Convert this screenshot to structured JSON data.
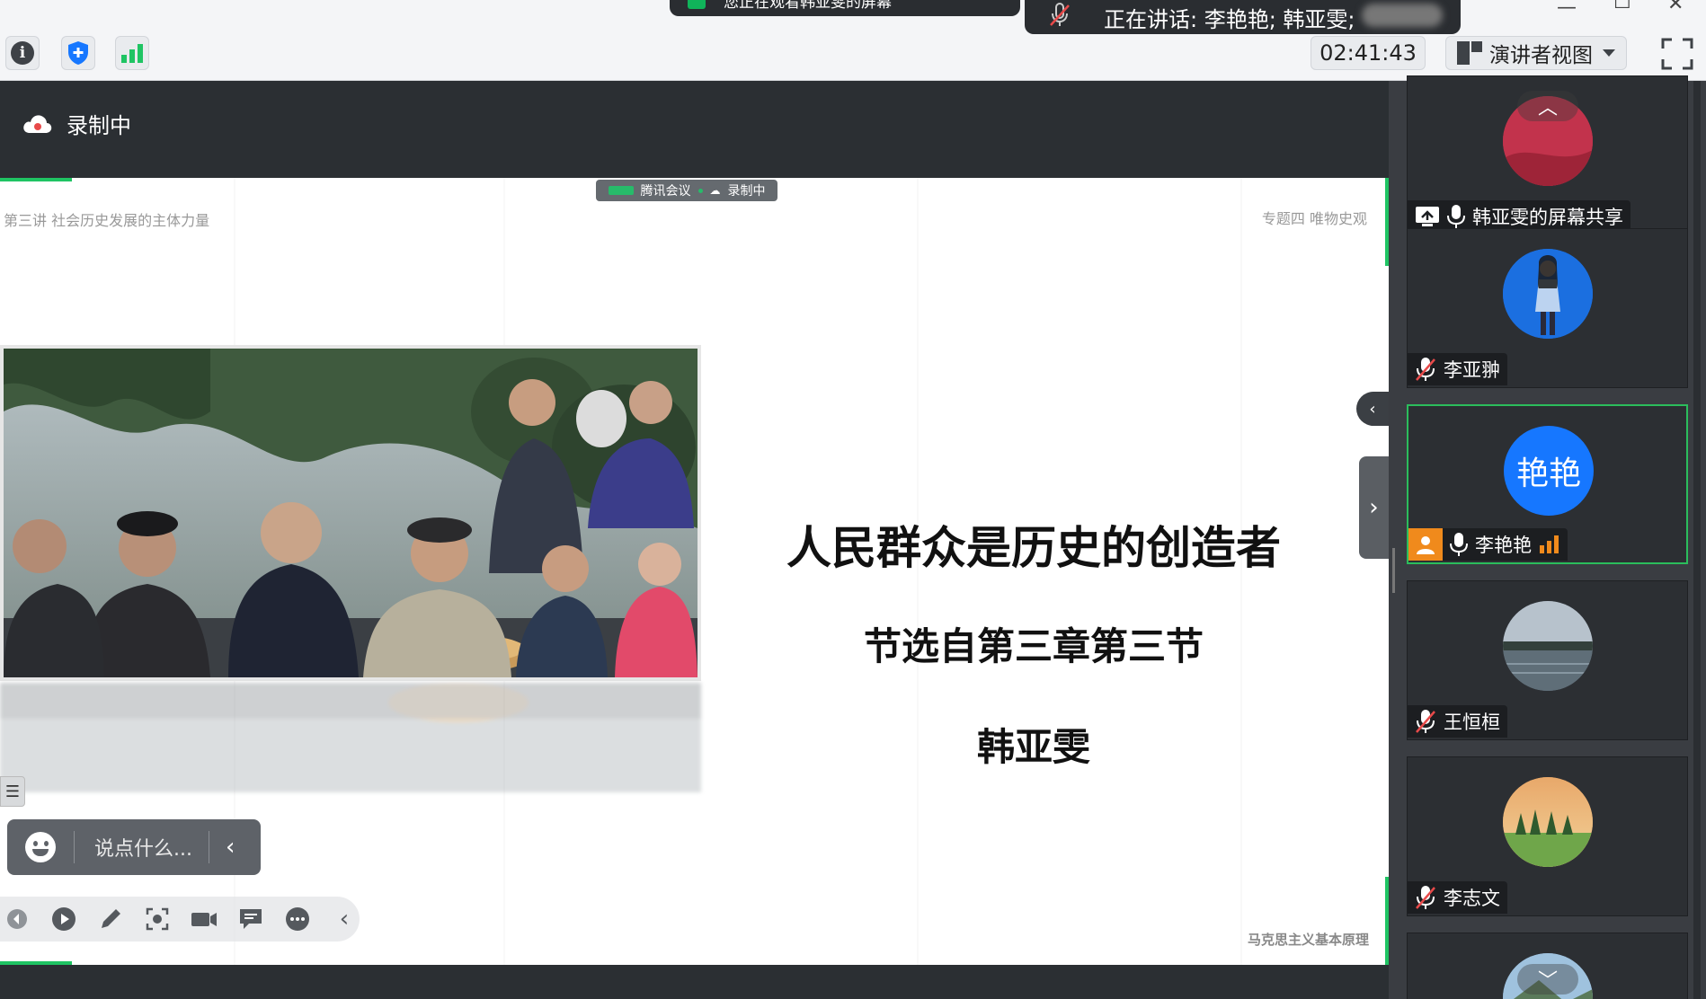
{
  "toolbar": {
    "timer": "02:41:43",
    "view_label": "演讲者视图"
  },
  "notifications": {
    "sharing": "您正在观看韩亚雯的屏幕",
    "speaking": "正在讲话: 李艳艳; 韩亚雯;"
  },
  "stage": {
    "recording_label": "录制中",
    "watermark": {
      "app": "腾讯会议",
      "recording": "录制中"
    }
  },
  "slide": {
    "header_left": "第三讲  社会历史发展的主体力量",
    "header_right": "专题四  唯物史观",
    "title": "人民群众是历史的创造者",
    "subtitle": "节选自第三章第三节",
    "author": "韩亚雯",
    "footer": "马克思主义基本原理"
  },
  "chat": {
    "placeholder": "说点什么..."
  },
  "participants": [
    {
      "name": "韩亚雯的屏幕共享",
      "avatar_color": "#c2334c",
      "mic": "on",
      "share_icon": true
    },
    {
      "name": "李亚翀",
      "avatar_color": "#1b6fe0",
      "mic": "muted"
    },
    {
      "name": "李艳艳",
      "avatar_text": "艳艳",
      "avatar_color": "#1677ff",
      "mic": "on",
      "active": true,
      "host": true
    },
    {
      "name": "王恒桓",
      "avatar_color": "#6d7a88",
      "mic": "muted"
    },
    {
      "name": "李志文",
      "avatar_color": "#d99650",
      "mic": "muted"
    }
  ],
  "colors": {
    "accent_green": "#1fc463",
    "active_border": "#2bbd5c",
    "avatar_blue": "#1677ff"
  }
}
